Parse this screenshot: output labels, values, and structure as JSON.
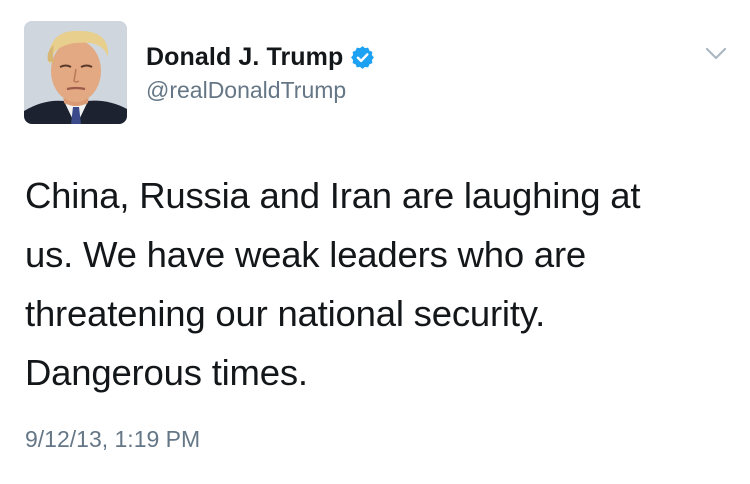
{
  "tweet": {
    "author": {
      "display_name": "Donald J. Trump",
      "handle": "@realDonaldTrump",
      "verified": true,
      "avatar_icon": "profile-photo",
      "verified_icon": "verified-badge-icon"
    },
    "menu_icon": "chevron-down-icon",
    "text_lines": [
      "China, Russia and Iran are laughing at",
      "us. We have weak leaders who are",
      "threatening our national security.",
      "Dangerous times."
    ],
    "timestamp": "9/12/13, 1:19 PM"
  },
  "colors": {
    "text_primary": "#14171a",
    "text_secondary": "#657786",
    "verified_blue": "#1da1f2",
    "chevron_gray": "#aab8c2",
    "background": "#ffffff"
  }
}
